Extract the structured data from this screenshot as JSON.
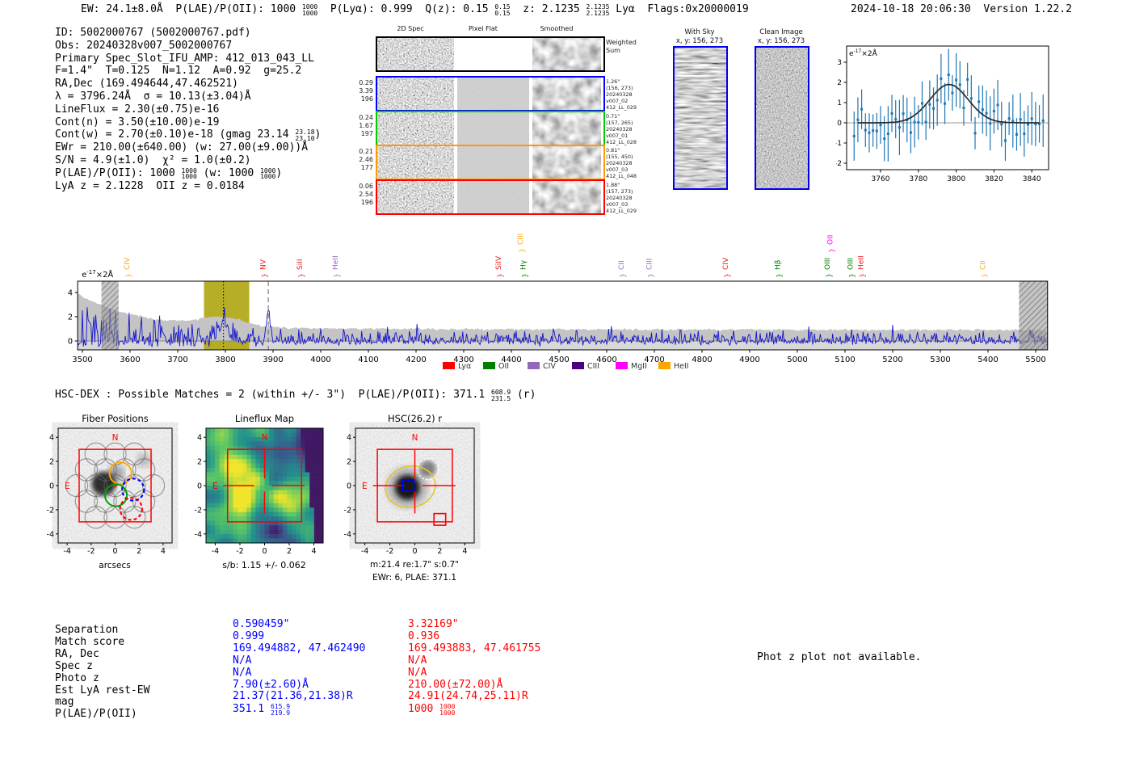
{
  "title_bar": {
    "summary_segments": [
      "EW: 24.1±8.0Å  P(LAE)/P(OII): 1000 ",
      {
        "f": [
          "1000",
          "1000"
        ]
      },
      "  P(Lyα): 0.999  Q(z): 0.15 ",
      {
        "f": [
          "0.15",
          "0.15"
        ]
      },
      "  z: 2.1235 ",
      {
        "f": [
          "2.1235",
          "2.1235"
        ]
      },
      " Lyα  Flags:0x20000019"
    ],
    "datetime": "2024-10-18 20:06:30",
    "version": "Version 1.22.2"
  },
  "info": {
    "lines": [
      [
        "ID: 5002000767 (5002000767.pdf)"
      ],
      [
        "Obs: 20240328v007_5002000767"
      ],
      [
        "Primary Spec_Slot_IFU_AMP: 412_013_043_LL"
      ],
      [
        "F=1.4\"  T=0.125  N=1.12  A=0.92  g=25.2"
      ],
      [
        "RA,Dec (169.494644,47.462521)"
      ],
      [
        "λ = 3796.24Å  σ = 10.13(±3.04)Å"
      ],
      [
        "LineFlux = 2.30(±0.75)e-16"
      ],
      [
        "Cont(n) = 3.50(±10.00)e-19"
      ],
      [
        "Cont(w) = 2.70(±0.10)e-18 (gmag 23.14 ",
        {
          "f": [
            "23.18",
            "23.10"
          ]
        },
        ")"
      ],
      [
        "EWr = 210.00(±640.00) (w: 27.00(±9.00))Å"
      ],
      [
        "S/N = 4.9(±1.0)  χ² = 1.0(±0.2)"
      ],
      [
        "P(LAE)/P(OII): 1000 ",
        {
          "f": [
            "1000",
            "1000"
          ]
        },
        " (w: 1000 ",
        {
          "f": [
            "1000",
            "1000"
          ]
        },
        ")"
      ],
      [
        "LyA z = 2.1228  OII z = 0.0184"
      ]
    ]
  },
  "spec2d": {
    "col_headers": [
      "2D Spec",
      "Pixel Flat",
      "Smoothed"
    ],
    "rows": [
      {
        "border": "#000000",
        "left": [],
        "right": [
          "Weighted",
          "Sum"
        ],
        "weighted": true
      },
      {
        "border": "#0000ff",
        "left": [
          "0.29",
          "3.39",
          "196"
        ],
        "right": [
          "1.26\"",
          "(156, 273)",
          "20240328",
          "v007_02",
          "412_LL_029"
        ],
        "weighted": false
      },
      {
        "border": "#00cc00",
        "left": [
          "0.24",
          "1.67",
          "197"
        ],
        "right": [
          "0.71\"",
          "(157, 265)",
          "20240328",
          "v007_01",
          "412_LL_028"
        ],
        "weighted": false
      },
      {
        "border": "#ff9900",
        "left": [
          "0.21",
          "2.46",
          "177"
        ],
        "right": [
          "0.81\"",
          "(155, 450)",
          "20240328",
          "v007_03",
          "412_LL_048"
        ],
        "weighted": false
      },
      {
        "border": "#ff0000",
        "left": [
          "0.06",
          "2.54",
          "196"
        ],
        "right": [
          "1.88\"",
          "(157, 273)",
          "20240328",
          "v007_03",
          "412_LL_029"
        ],
        "weighted": false
      }
    ]
  },
  "sky_panels": {
    "with_sky": {
      "title": "With Sky",
      "subtitle": "x, y: 156, 273"
    },
    "clean": {
      "title": "Clean Image",
      "subtitle": "x, y: 156, 273"
    }
  },
  "hsc_dex": {
    "segments": [
      "HSC-DEX : Possible Matches = 2 (within +/- 3\")  P(LAE)/P(OII): 371.1 ",
      {
        "f": [
          "608.9",
          "231.5"
        ]
      },
      " (r)"
    ]
  },
  "match_table": {
    "labels": [
      "Separation",
      "Match score",
      "RA, Dec",
      "Spec z",
      "Photo z",
      "Est LyA rest-EW",
      "mag",
      "P(LAE)/P(OII)"
    ],
    "col1_color": "#0000ff",
    "col2_color": "#ff0000",
    "col1": [
      [
        "0.590459\""
      ],
      [
        "0.999"
      ],
      [
        "169.494882, 47.462490"
      ],
      [
        "N/A"
      ],
      [
        "N/A"
      ],
      [
        "7.90(±2.60)Å"
      ],
      [
        "21.37(21.36,21.38)R"
      ],
      [
        "351.1 ",
        {
          "f": [
            "615.9",
            "219.9"
          ]
        }
      ]
    ],
    "col2": [
      [
        "3.32169\""
      ],
      [
        "0.936"
      ],
      [
        "169.493883, 47.461755"
      ],
      [
        "N/A"
      ],
      [
        "N/A"
      ],
      [
        "210.00(±72.00)Å"
      ],
      [
        "24.91(24.74,25.11)R"
      ],
      [
        "1000 ",
        {
          "f": [
            "1000",
            "1000"
          ]
        }
      ]
    ]
  },
  "notices": {
    "photz": "Phot z plot not available."
  },
  "chart_data": [
    {
      "id": "line_fit_inset",
      "type": "scatter",
      "y_unit_label": {
        "base": "e",
        "exp": "-17",
        "scale": "×2Å"
      },
      "xlim": [
        3742,
        3849
      ],
      "ylim": [
        -2.32,
        3.8
      ],
      "x_ticks": [
        3760,
        3780,
        3800,
        3820,
        3840
      ],
      "y_ticks": [
        -2,
        -1,
        0,
        1,
        2,
        3
      ],
      "fit": {
        "center": 3796.24,
        "sigma": 10.13,
        "amplitude": 1.9
      },
      "point_color": "#1f77b4",
      "fit_color": "#2b2b2b",
      "zero_line_color": "#999999"
    },
    {
      "id": "full_spectrum",
      "type": "line",
      "y_unit_label": {
        "base": "e",
        "exp": "-17",
        "scale": "×2Å"
      },
      "xlim": [
        3490,
        5525
      ],
      "ylim": [
        -0.73,
        4.93
      ],
      "x_ticks": [
        3500,
        3600,
        3700,
        3800,
        3900,
        4000,
        4100,
        4200,
        4300,
        4400,
        4500,
        4600,
        4700,
        4800,
        4900,
        5000,
        5100,
        5200,
        5300,
        5400,
        5500
      ],
      "y_ticks": [
        0,
        2,
        4
      ],
      "spectrum_color": "#1414cc",
      "noise_envelope_color": "#c4c4c4",
      "detected_line": {
        "wavelength": 3796.24,
        "sigma": 10.13,
        "amplitude": 1.5
      },
      "secondary_peak": {
        "wavelength": 3890,
        "amplitude": 2.4
      },
      "bands": [
        {
          "x0": 3540,
          "x1": 3576,
          "style": "hatched"
        },
        {
          "x0": 3755,
          "x1": 3850,
          "style": "olive",
          "color": "#b3aa1c"
        },
        {
          "x0": 5465,
          "x1": 5525,
          "style": "hatched"
        }
      ],
      "vlines": [
        {
          "x": 3796,
          "style": "dotted",
          "color": "#000000"
        },
        {
          "x": 3890,
          "style": "dashed",
          "color": "#666666"
        }
      ],
      "line_labels": [
        {
          "text": "CIV",
          "wavelength": 3592,
          "color": "#ffa500",
          "raised": false
        },
        {
          "text": "NV",
          "wavelength": 3878,
          "color": "#f01818",
          "raised": false
        },
        {
          "text": "SiII",
          "wavelength": 3955,
          "color": "#f01818",
          "raised": false
        },
        {
          "text": "HeII",
          "wavelength": 4030,
          "color": "#9467bd",
          "raised": false
        },
        {
          "text": "SiIV",
          "wavelength": 4372,
          "color": "#f01818",
          "raised": false
        },
        {
          "text": "Hγ",
          "wavelength": 4424,
          "color": "#008000",
          "raised": false
        },
        {
          "text": "CIII",
          "wavelength": 4418,
          "color": "#ffa500",
          "raised": true
        },
        {
          "text": "CII",
          "wavelength": 4630,
          "color": "#9467bd",
          "raised": false
        },
        {
          "text": "CIII",
          "wavelength": 4688,
          "color": "#9467bd",
          "raised": false
        },
        {
          "text": "CIV",
          "wavelength": 4848,
          "color": "#f01818",
          "raised": false
        },
        {
          "text": "Hβ",
          "wavelength": 4958,
          "color": "#008000",
          "raised": false
        },
        {
          "text": "OIII",
          "wavelength": 5062,
          "color": "#008000",
          "raised": false
        },
        {
          "text": "OII",
          "wavelength": 5068,
          "color": "#ff00ff",
          "raised": true
        },
        {
          "text": "OIII",
          "wavelength": 5110,
          "color": "#008000",
          "raised": false
        },
        {
          "text": "HeII",
          "wavelength": 5132,
          "color": "#f01818",
          "raised": false
        },
        {
          "text": "CII",
          "wavelength": 5388,
          "color": "#ffa500",
          "raised": false
        }
      ],
      "legend": [
        {
          "label": "Lyα",
          "color": "#ff0000"
        },
        {
          "label": "OII",
          "color": "#008000"
        },
        {
          "label": "CIV",
          "color": "#9467bd"
        },
        {
          "label": "CIII",
          "color": "#4b0082"
        },
        {
          "label": "MgII",
          "color": "#ff00ff"
        },
        {
          "label": "HeII",
          "color": "#ffa500"
        }
      ]
    },
    {
      "id": "fiber_positions",
      "type": "image-overlay",
      "title": "Fiber Positions",
      "xlabel": "arcsecs",
      "ticks": [
        -4,
        -2,
        0,
        2,
        4
      ],
      "compass": {
        "north": "N",
        "east": "E"
      },
      "frame_box_arcsec": 3,
      "fiber_radius_arcsec": 0.92,
      "highlight_fibers": [
        {
          "color": "#ffa500",
          "x": 0.45,
          "y": 1.02,
          "dashed": false
        },
        {
          "color": "#0000ff",
          "x": 1.5,
          "y": -0.33,
          "dashed": true
        },
        {
          "color": "#00a000",
          "x": 0.07,
          "y": -0.8,
          "dashed": false
        },
        {
          "color": "#ff0000",
          "x": 1.33,
          "y": -1.93,
          "dashed": true
        }
      ]
    },
    {
      "id": "lineflux_map",
      "type": "heatmap",
      "title": "Lineflux Map",
      "xlabel": "s/b: 1.15 +/- 0.062",
      "ticks": [
        -4,
        -2,
        0,
        2,
        4
      ],
      "compass": {
        "north": "N",
        "east": "E"
      },
      "frame_box_arcsec": 3,
      "colormap": "viridis"
    },
    {
      "id": "hsc_r_cutout",
      "type": "image-overlay",
      "title": "HSC(26.2) r",
      "xlabel_lines": [
        "m:21.4  re:1.7\"  s:0.7\"",
        "EWr: 6, PLAE: 371.1"
      ],
      "ticks": [
        -4,
        -2,
        0,
        2,
        4
      ],
      "compass": {
        "north": "N",
        "east": "E"
      },
      "frame_box_arcsec": 3,
      "markers": {
        "aperture_ellipse": {
          "color": "#e3c530",
          "x": -0.35,
          "y": -0.1,
          "rx": 2.0,
          "ry": 1.7
        },
        "catalog_square": {
          "color": "#0000ee",
          "x": -0.55,
          "y": 0.0,
          "size": 0.9
        },
        "neighbor_square": {
          "color": "#ff0000",
          "x": 2.0,
          "y": -2.8,
          "size": 0.55
        },
        "neighbor_circle": {
          "color": "#ffffff",
          "x": 1.05,
          "y": 1.35,
          "r": 0.85,
          "dashed": true
        }
      }
    }
  ]
}
